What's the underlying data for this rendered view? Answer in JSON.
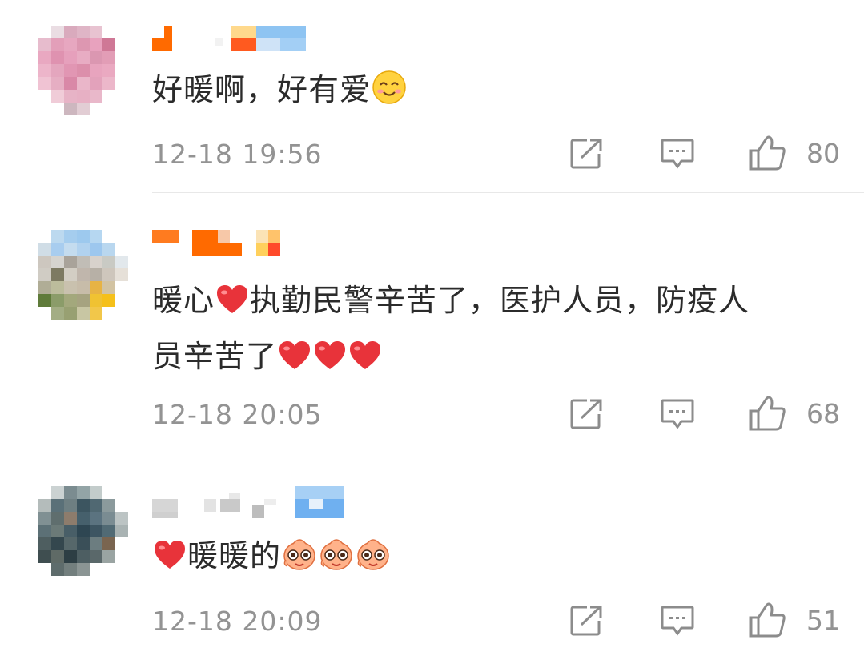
{
  "comments": [
    {
      "text_parts": [
        "好暖啊，好有爱"
      ],
      "timestamp": "12-18 19:56",
      "likes": "80",
      "emojis": [
        "smile-emoji"
      ]
    },
    {
      "text_parts": [
        "暖心",
        "执勤民警辛苦了，医护人员，防疫人",
        "员辛苦了"
      ],
      "timestamp": "12-18 20:05",
      "likes": "68",
      "emojis": [
        "heart-emoji",
        "heart-emoji",
        "heart-emoji",
        "heart-emoji"
      ]
    },
    {
      "text_parts": [
        "暖暖的"
      ],
      "timestamp": "12-18 20:09",
      "likes": "51",
      "emojis": [
        "heart-emoji",
        "doge-emoji",
        "doge-emoji",
        "doge-emoji"
      ]
    }
  ],
  "icons": {
    "repost": "repost-icon",
    "comment": "comment-icon",
    "like": "like-icon"
  },
  "colors": {
    "text": "#2b2b2b",
    "meta": "#939393",
    "icon": "#8c8c8c",
    "heart": "#e8333a",
    "divider": "#e8e8e8"
  }
}
